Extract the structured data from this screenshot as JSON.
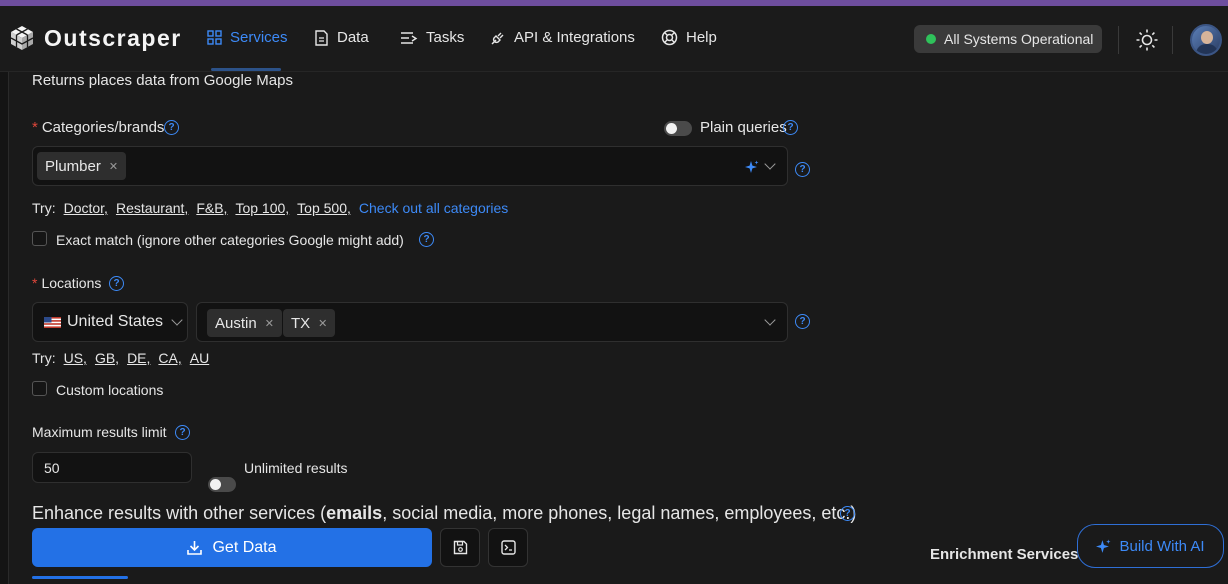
{
  "app": {
    "name": "Outscraper"
  },
  "nav": {
    "items": [
      {
        "label": "Services",
        "icon": "grid-icon",
        "active": true
      },
      {
        "label": "Data",
        "icon": "document-icon"
      },
      {
        "label": "Tasks",
        "icon": "list-icon"
      },
      {
        "label": "API & Integrations",
        "icon": "plug-icon"
      },
      {
        "label": "Help",
        "icon": "lifebuoy-icon"
      }
    ],
    "status": "All Systems Operational"
  },
  "form": {
    "description": "Returns places data from Google Maps",
    "categories": {
      "label": "Categories/brands",
      "plain_queries_label": "Plain queries",
      "tags": [
        "Plumber"
      ],
      "try_label": "Try:",
      "try_links": [
        "Doctor,",
        "Restaurant,",
        "F&B,",
        "Top 100,",
        "Top 500,"
      ],
      "all_link": "Check out all categories",
      "exact_match_label": "Exact match (ignore other categories Google might add)"
    },
    "locations": {
      "label": "Locations",
      "country": "United States",
      "tags": [
        "Austin",
        "TX"
      ],
      "try_label": "Try:",
      "try_links": [
        "US,",
        "GB,",
        "DE,",
        "CA,",
        "AU"
      ],
      "custom_label": "Custom locations"
    },
    "limit": {
      "label": "Maximum results limit",
      "value": "50",
      "unlimited_label": "Unlimited results"
    },
    "enhance": {
      "prefix": "Enhance results with other services (",
      "bold": "emails",
      "suffix": ", social media, more phones, legal names, employees, etc.)"
    },
    "get_data_label": "Get Data",
    "enrichment_label": "Enrichment Services:",
    "build_ai_label": "Build With AI"
  },
  "colors": {
    "accent": "#2371e6",
    "link": "#3d8af7",
    "status_ok": "#2fc25b",
    "required": "#e0473b"
  }
}
